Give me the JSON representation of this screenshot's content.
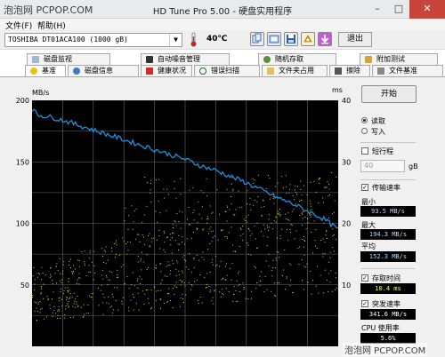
{
  "watermark": "泡泡网 PCPOP.COM",
  "window": {
    "title": "HD Tune Pro 5.00 - 硬盘实用程序",
    "minimize": "–",
    "maximize": "□",
    "close": "✕"
  },
  "menu": {
    "file": "文件(F)",
    "help": "帮助(H)"
  },
  "toolbar": {
    "drive": "TOSHIBA DT01ACA100 (1000 gB)",
    "temperature": "40℃",
    "exit_label": "退出",
    "icons": [
      "copy-icon",
      "copy-screen-icon",
      "save-icon",
      "options-icon",
      "download-icon"
    ]
  },
  "tabs_row1": [
    "磁盘监视",
    "自动噪音管理",
    "随机存取",
    "附加测试"
  ],
  "tabs_row2": [
    "基准",
    "磁盘信息",
    "健康状况",
    "错误扫描",
    "文件夹占用",
    "擦除",
    "文件基准"
  ],
  "chart": {
    "left_unit": "MB/s",
    "right_unit": "ms",
    "left_ticks": [
      "200",
      "150",
      "100",
      "50"
    ],
    "right_ticks": [
      "40",
      "30",
      "20",
      "10"
    ]
  },
  "chart_data": {
    "type": "line",
    "xlabel": "",
    "ylabel": "MB/s",
    "y2label": "ms",
    "ylim": [
      0,
      200
    ],
    "y2lim": [
      0,
      40
    ],
    "grid": true,
    "series": [
      {
        "name": "传输速率",
        "color": "#1e8fd8",
        "x": [
          0,
          2,
          5,
          10,
          15,
          20,
          25,
          30,
          35,
          40,
          45,
          50,
          55,
          60,
          65,
          70,
          75,
          80,
          85,
          90,
          95,
          100
        ],
        "values": [
          193,
          188,
          187,
          184,
          180,
          176,
          172,
          168,
          164,
          160,
          156,
          152,
          147,
          143,
          138,
          133,
          127,
          121,
          116,
          110,
          104,
          95
        ]
      }
    ],
    "scatter_series": {
      "name": "存取时间",
      "color": "#d8d840",
      "y_band_ms": [
        [
          4,
          13
        ],
        [
          17,
          28
        ]
      ],
      "average_ms": 10.4
    }
  },
  "sidebar": {
    "start_label": "开始",
    "read_label": "读取",
    "write_label": "写入",
    "short_stroke_label": "短行程",
    "short_stroke_value": "40",
    "short_stroke_unit": "gB",
    "transfer_label": "传输速率",
    "min_label": "最小",
    "min_value": "93.5 MB/s",
    "max_label": "最大",
    "max_value": "194.3 MB/s",
    "avg_label": "平均",
    "avg_value": "152.3 MB/s",
    "access_label": "存取时间",
    "access_value": "10.4 ms",
    "burst_label": "突发速率",
    "burst_value": "341.6 MB/s",
    "cpu_label": "CPU 使用率",
    "cpu_value": "5.6%"
  }
}
